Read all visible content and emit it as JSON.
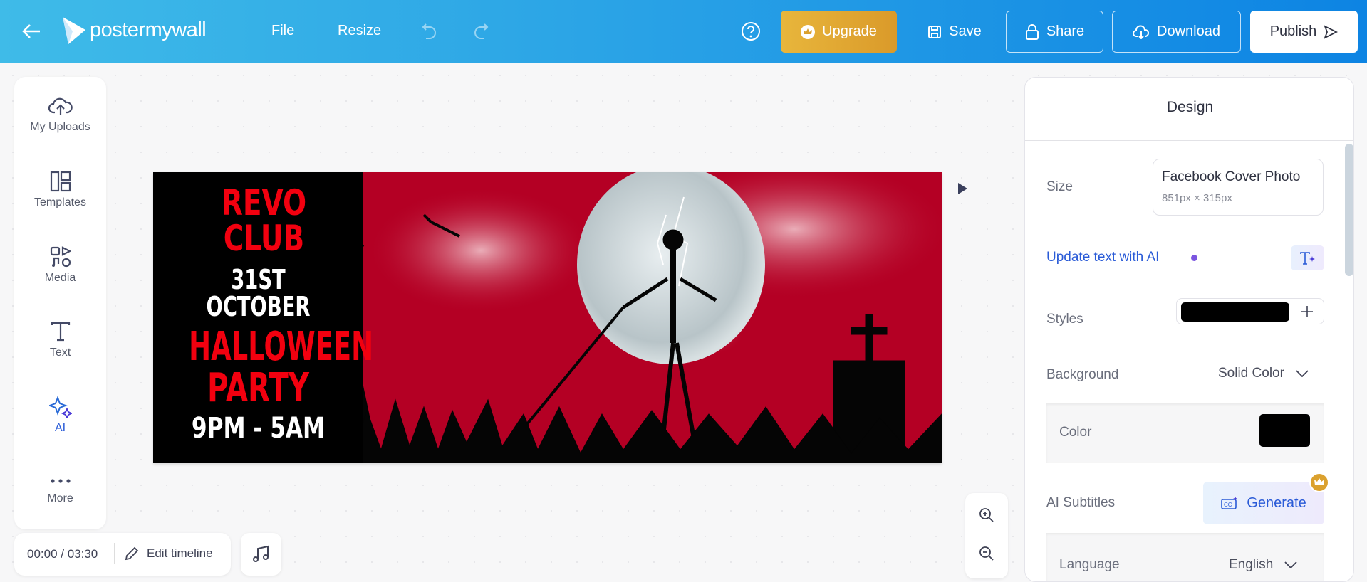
{
  "header": {
    "brand": "postermywall",
    "menu": [
      "File",
      "Resize"
    ],
    "upgrade_label": "Upgrade",
    "save_label": "Save",
    "share_label": "Share",
    "download_label": "Download",
    "publish_label": "Publish"
  },
  "sidebar": {
    "items": [
      {
        "label": "My Uploads"
      },
      {
        "label": "Templates"
      },
      {
        "label": "Media"
      },
      {
        "label": "Text"
      },
      {
        "label": "AI"
      },
      {
        "label": "More"
      }
    ]
  },
  "poster": {
    "line1": "REVO CLUB",
    "line2": "31ST OCTOBER",
    "line3": "HALLOWEEN",
    "line4": "PARTY",
    "line5": "9PM - 5AM"
  },
  "timeline": {
    "time": "00:00 / 03:30",
    "edit_label": "Edit timeline"
  },
  "panel": {
    "title": "Design",
    "size_label": "Size",
    "size_name": "Facebook Cover Photo",
    "size_dims": "851px × 315px",
    "ai_text_label": "Update text with AI",
    "styles_label": "Styles",
    "background_label": "Background",
    "background_value": "Solid Color",
    "color_label": "Color",
    "color_value": "#000000",
    "subtitles_label": "AI Subtitles",
    "generate_label": "Generate",
    "language_label": "Language",
    "language_value": "English"
  },
  "colors": {
    "accent": "#1e88e5",
    "upgrade": "#e0a62e",
    "poster_red": "#b40024",
    "ai_blue": "#2a5bd7"
  }
}
